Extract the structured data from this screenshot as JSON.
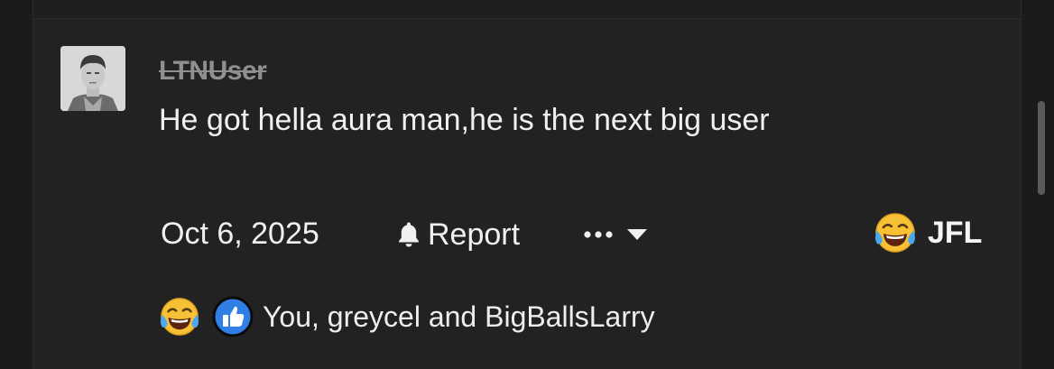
{
  "comment": {
    "username": "LTNUser",
    "message": "He got hella aura man,he is the next big user",
    "date": "Oct 6, 2025",
    "report_label": "Report",
    "reaction_label": "JFL",
    "reactors_text": "You, greycel and BigBallsLarry"
  },
  "icons": {
    "avatar": "user-avatar-photo",
    "report": "bell-icon",
    "more": "ellipsis-icon",
    "dropdown": "chevron-down-icon",
    "reaction": "tears-of-joy-emoji",
    "like": "thumbs-up-icon"
  },
  "colors": {
    "background": "#1b1b1b",
    "panel": "#222222",
    "text": "#f0f0f0",
    "username": "#8f8f8f",
    "like_blue": "#2f7fe6"
  }
}
